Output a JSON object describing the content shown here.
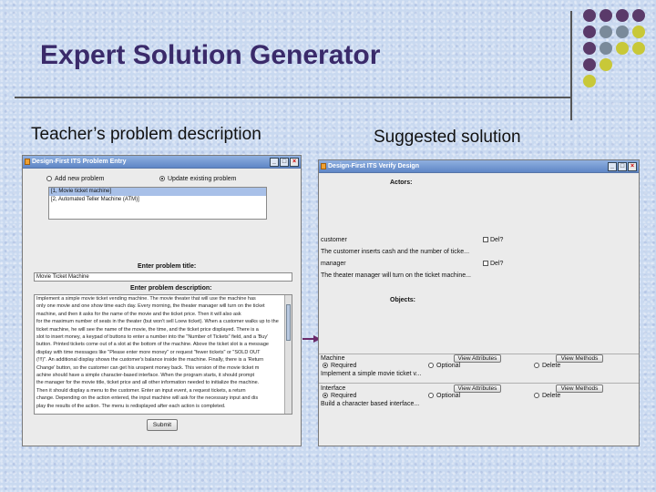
{
  "slide": {
    "title": "Expert Solution Generator",
    "caption_left": "Teacher’s problem description",
    "caption_right": "Suggested solution",
    "dot_colors": [
      "#5a3a6a",
      "#7a8a9a",
      "#c8c838"
    ]
  },
  "left_window": {
    "title": "Design-First ITS Problem Entry",
    "radio_add": "Add new problem",
    "radio_update": "Update existing problem",
    "problems": [
      "[1, Movie ticket machine]",
      "[2, Automated Teller Machine (ATM)]"
    ],
    "enter_title_label": "Enter problem title:",
    "title_value": "Movie Ticket Machine",
    "enter_desc_label": "Enter problem description:",
    "description_lines": [
      "Implement a simple movie ticket vending machine. The movie theater that will use the machine has",
      "only one movie and one show time each day. Every morning, the theater manager will turn on the ticket",
      "machine, and then it asks for the name of the movie and the ticket price. Then it will also ask",
      "for the maximum number of seats in the theater (but won't sell Loew ticket). When a customer walks up to the",
      "ticket machine, he will see the name of the movie, the time, and the ticket price displayed. There is a",
      "slot to insert money, a keypad of buttons to enter a number into the \"Number of Tickets\" field, and a 'Buy'",
      "button. Printed tickets come out of a slot at the bottom of the machine. Above the ticket slot is a message",
      "display with time messages like \"Please enter more money\" or request \"fewer tickets\" or \"SOLD OUT",
      "(!!!)\". An additional display shows the customer's balance inside the machine. Finally, there is a 'Return",
      "Change' button, so the customer can get his unspent money back. This version of the movie ticket m",
      "achine should have a simple character-based interface. When the program starts, it should prompt",
      "the manager for the movie title, ticket price and all other information needed to initialize the machine.",
      "Then it should display a menu to the customer. Enter an input event, a request tickets, a return",
      "change. Depending on the action entered, the input machine will ask for the necessary input and dis",
      "play the results of the action. The menu is redisplayed after each action is completed."
    ],
    "submit_label": "Submit"
  },
  "right_window": {
    "title": "Design-First ITS Verify Design",
    "actors_label": "Actors:",
    "actors": [
      {
        "name": "customer",
        "checkbox_label": "Del?",
        "description": "The customer inserts cash and the number of ticke..."
      },
      {
        "name": "manager",
        "checkbox_label": "Del?",
        "description": "The theater manager will turn on the ticket machine..."
      }
    ],
    "objects_label": "Objects:",
    "objects": [
      {
        "name": "Machine",
        "description": "Implement a simple movie ticket v...",
        "required": "Required",
        "optional": "Optional",
        "view_attributes": "View Attributes",
        "view_methods": "View Methods",
        "delete": "Delete"
      },
      {
        "name": "Interface",
        "description": "Build a character based interface...",
        "required": "Required",
        "optional": "Optional",
        "view_attributes": "View Attributes",
        "view_methods": "View Methods",
        "delete": "Delete"
      }
    ]
  }
}
